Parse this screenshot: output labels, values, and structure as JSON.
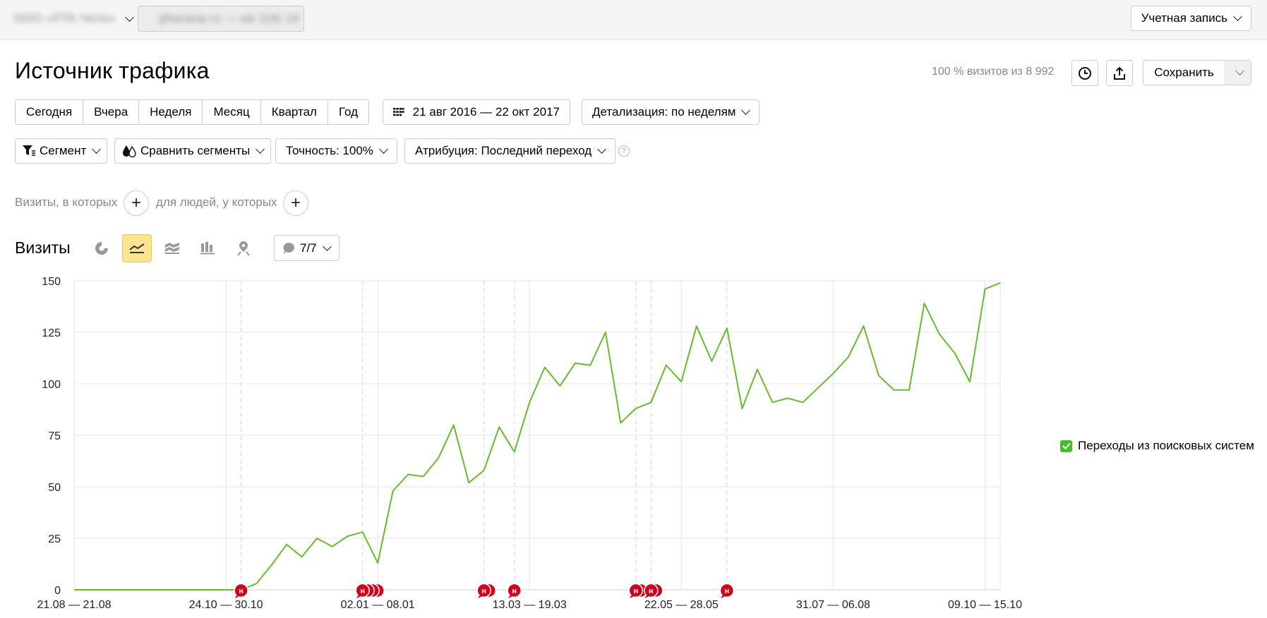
{
  "header": {
    "counter_name": "ООО «РТК Чёлн»",
    "counter_url": "pharana.ru — на 1(4) 14",
    "account_label": "Учетная запись"
  },
  "page": {
    "title": "Источник трафика",
    "visits_info": "100 % визитов из 8 992",
    "save_label": "Сохранить"
  },
  "periods": [
    "Сегодня",
    "Вчера",
    "Неделя",
    "Месяц",
    "Квартал",
    "Год"
  ],
  "date_range": "21 авг 2016 — 22 окт 2017",
  "detail_label": "Детализация: по неделям",
  "toolbar2": {
    "segment": "Сегмент",
    "compare": "Сравнить сегменты",
    "accuracy": "Точность: 100%",
    "attribution": "Атрибуция: Последний переход",
    "help": "?"
  },
  "filters": {
    "visits_where": "Визиты, в которых",
    "people_where": "для людей, у которых"
  },
  "visits_section": {
    "title": "Визиты",
    "notes_label": "7/7",
    "chart_type_icons": [
      "pie-chart-icon",
      "line-chart-icon",
      "area-chart-icon",
      "bar-chart-icon",
      "map-icon"
    ]
  },
  "legend": {
    "label": "Переходы из поисковых систем",
    "color": "#4cba31"
  },
  "colors": {
    "line": "#66bb2e",
    "annotation": "#d0021b",
    "active_chart_type": "#fce58e"
  },
  "chart_data": {
    "type": "line",
    "ylim": [
      0,
      150
    ],
    "yticks": [
      0,
      25,
      50,
      75,
      100,
      125,
      150
    ],
    "x_tick_labels": [
      {
        "index": 0,
        "label": "21.08 — 21.08"
      },
      {
        "index": 10,
        "label": "24.10 — 30.10"
      },
      {
        "index": 20,
        "label": "02.01 — 08.01"
      },
      {
        "index": 30,
        "label": "13.03 — 19.03"
      },
      {
        "index": 40,
        "label": "22.05 — 28.05"
      },
      {
        "index": 50,
        "label": "31.07 — 06.08"
      },
      {
        "index": 60,
        "label": "09.10 — 15.10"
      }
    ],
    "x_count": 62,
    "series": [
      {
        "name": "Переходы из поисковых систем",
        "values": [
          0,
          0,
          0,
          0,
          0,
          0,
          0,
          0,
          0,
          0,
          0,
          0,
          3,
          12,
          22,
          16,
          25,
          21,
          26,
          28,
          13,
          48,
          56,
          55,
          64,
          80,
          52,
          58,
          79,
          67,
          91,
          108,
          99,
          110,
          109,
          125,
          81,
          88,
          91,
          109,
          101,
          128,
          111,
          127,
          88,
          107,
          91,
          93,
          91,
          98,
          105,
          113,
          128,
          104,
          97,
          97,
          139,
          124,
          115,
          101,
          146,
          149
        ]
      }
    ],
    "note_markers": [
      {
        "index": 11,
        "count": 1
      },
      {
        "index": 19,
        "count": 4
      },
      {
        "index": 27,
        "count": 2
      },
      {
        "index": 29,
        "count": 1
      },
      {
        "index": 37,
        "count": 2
      },
      {
        "index": 38,
        "count": 2
      },
      {
        "index": 43,
        "count": 1
      }
    ],
    "note_label": "н"
  }
}
